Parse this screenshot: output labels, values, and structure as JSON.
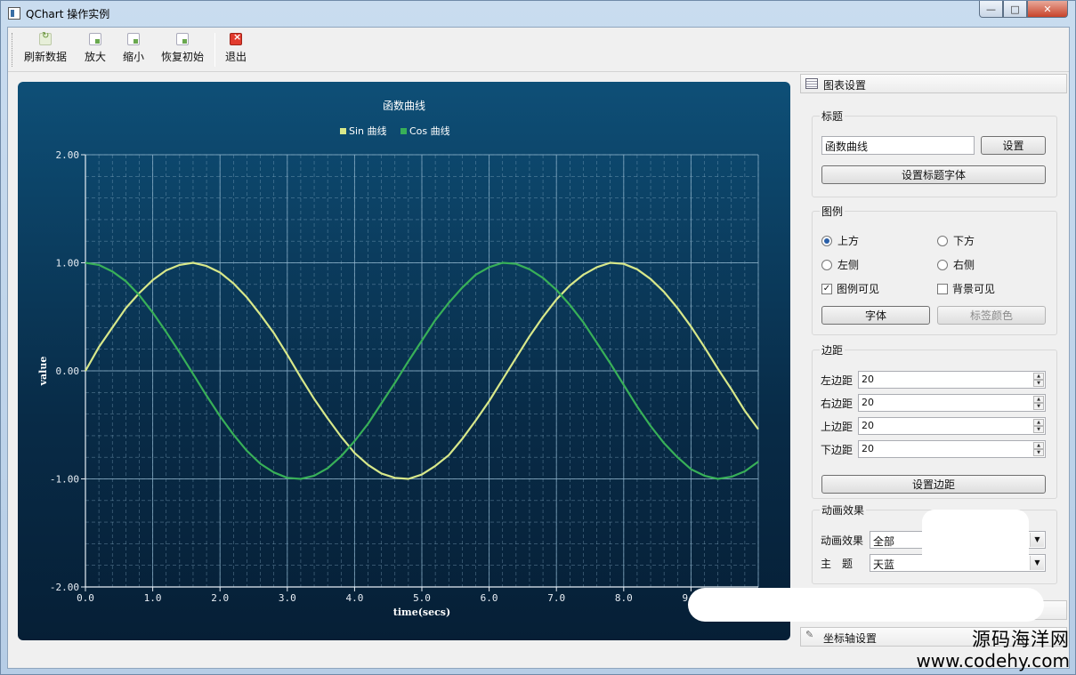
{
  "window": {
    "title": "QChart 操作实例",
    "min_label": "—",
    "max_label": "□",
    "close_label": "✕"
  },
  "toolbar": {
    "refresh_label": "刷新数据",
    "zoom_in_label": "放大",
    "zoom_out_label": "缩小",
    "reset_label": "恢复初始",
    "exit_label": "退出"
  },
  "chart_data": {
    "type": "line",
    "title": "函数曲线",
    "xlabel": "time(secs)",
    "ylabel": "value",
    "xlim": [
      0,
      10
    ],
    "ylim": [
      -2,
      2
    ],
    "x_ticks": [
      "0.0",
      "1.0",
      "2.0",
      "3.0",
      "4.0",
      "5.0",
      "6.0",
      "7.0",
      "8.0",
      "9.0"
    ],
    "y_ticks": [
      "2.00",
      "1.00",
      "0.00",
      "-1.00",
      "-2.00"
    ],
    "grid": true,
    "legend": "top",
    "colors": {
      "sin": "#d8e88a",
      "cos": "#38b058",
      "grid": "#8fb4cc",
      "background_top": "#0e4f77",
      "background_bottom": "#061f36"
    },
    "x": [
      0.0,
      0.2,
      0.4,
      0.6,
      0.8,
      1.0,
      1.2,
      1.4,
      1.6,
      1.8,
      2.0,
      2.2,
      2.4,
      2.6,
      2.8,
      3.0,
      3.2,
      3.4,
      3.6,
      3.8,
      4.0,
      4.2,
      4.4,
      4.6,
      4.8,
      5.0,
      5.2,
      5.4,
      5.6,
      5.8,
      6.0,
      6.2,
      6.4,
      6.6,
      6.8,
      7.0,
      7.2,
      7.4,
      7.6,
      7.8,
      8.0,
      8.2,
      8.4,
      8.6,
      8.8,
      9.0,
      9.2,
      9.4,
      9.6,
      9.8,
      10.0
    ],
    "series": [
      {
        "name": "Sin 曲线",
        "values": [
          0.0,
          0.22,
          0.4,
          0.58,
          0.72,
          0.84,
          0.93,
          0.98,
          1.0,
          0.97,
          0.91,
          0.81,
          0.68,
          0.52,
          0.35,
          0.15,
          -0.06,
          -0.26,
          -0.44,
          -0.61,
          -0.76,
          -0.87,
          -0.95,
          -0.99,
          -1.0,
          -0.96,
          -0.88,
          -0.78,
          -0.63,
          -0.46,
          -0.28,
          -0.08,
          0.12,
          0.32,
          0.5,
          0.66,
          0.79,
          0.89,
          0.96,
          1.0,
          0.99,
          0.94,
          0.85,
          0.73,
          0.58,
          0.41,
          0.22,
          0.02,
          -0.17,
          -0.37,
          -0.54
        ]
      },
      {
        "name": "Cos 曲线",
        "values": [
          1.0,
          0.98,
          0.92,
          0.83,
          0.7,
          0.54,
          0.36,
          0.17,
          -0.03,
          -0.23,
          -0.42,
          -0.59,
          -0.74,
          -0.86,
          -0.94,
          -0.99,
          -1.0,
          -0.97,
          -0.9,
          -0.79,
          -0.65,
          -0.49,
          -0.3,
          -0.11,
          0.09,
          0.28,
          0.47,
          0.63,
          0.77,
          0.89,
          0.96,
          1.0,
          0.99,
          0.94,
          0.86,
          0.75,
          0.61,
          0.45,
          0.26,
          0.07,
          -0.13,
          -0.33,
          -0.51,
          -0.67,
          -0.8,
          -0.91,
          -0.97,
          -1.0,
          -0.98,
          -0.93,
          -0.84
        ]
      }
    ]
  },
  "settings": {
    "header": "图表设置",
    "title_group": {
      "label": "标题",
      "value": "函数曲线",
      "set_button": "设置",
      "font_button": "设置标题字体"
    },
    "legend_group": {
      "label": "图例",
      "top": "上方",
      "bottom": "下方",
      "left": "左侧",
      "right": "右侧",
      "legend_visible": "图例可见",
      "background_visible": "背景可见",
      "font_button": "字体",
      "label_color_button": "标签颜色",
      "check_mark": "✓"
    },
    "margin_group": {
      "label": "边距",
      "left_label": "左边距",
      "left_value": "20",
      "right_label": "右边距",
      "right_value": "20",
      "top_label": "上边距",
      "top_value": "20",
      "bottom_label": "下边距",
      "bottom_value": "20",
      "set_button": "设置边距"
    },
    "animation_group": {
      "label": "动画效果",
      "effect_label": "动画效果",
      "effect_value": "全部",
      "theme_label": "主　题",
      "theme_value": "天蓝"
    },
    "axis_header": "坐标轴设置"
  },
  "watermark": {
    "line1": "源码海洋网",
    "line2": "www.codehy.com"
  }
}
